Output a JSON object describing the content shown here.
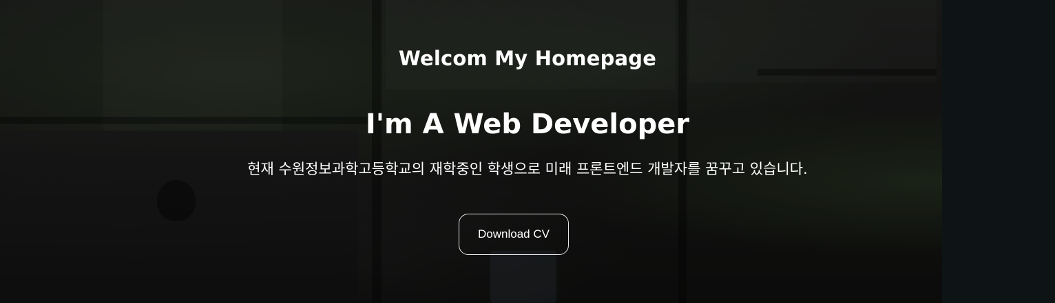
{
  "hero": {
    "greeting": "Welcom My Homepage",
    "headline": "I'm A Web Developer",
    "intro": "현재 수원정보과학고등학교의 재학중인 학생으로 미래 프론트엔드 개발자를 꿈꾸고 있습니다.",
    "cta_label": "Download CV"
  },
  "colors": {
    "text": "#ffffff",
    "background": "#1a1a19",
    "button_border": "#ffffff"
  }
}
